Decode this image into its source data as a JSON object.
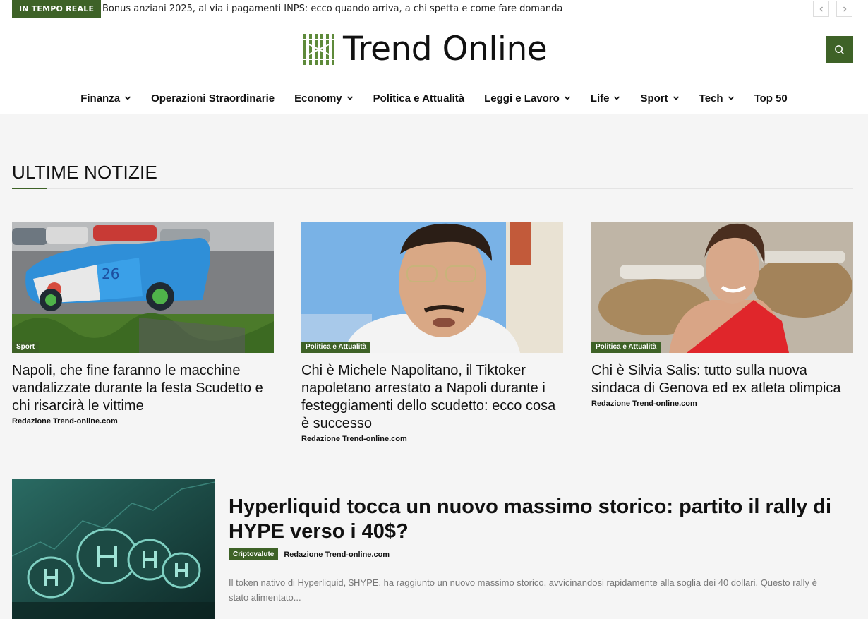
{
  "ticker": {
    "badge": "IN TEMPO REALE",
    "headline": "Bonus anziani 2025, al via i pagamenti INPS: ecco quando arriva, a chi spetta e come fare domanda"
  },
  "brand": {
    "name": "Trend Online",
    "accent_color": "#3e6227"
  },
  "nav": {
    "items": [
      {
        "label": "Finanza",
        "has_dropdown": true
      },
      {
        "label": "Operazioni Straordinarie",
        "has_dropdown": false
      },
      {
        "label": "Economy",
        "has_dropdown": true
      },
      {
        "label": "Politica e Attualità",
        "has_dropdown": false
      },
      {
        "label": "Leggi e Lavoro",
        "has_dropdown": true
      },
      {
        "label": "Life",
        "has_dropdown": true
      },
      {
        "label": "Sport",
        "has_dropdown": true
      },
      {
        "label": "Tech",
        "has_dropdown": true
      },
      {
        "label": "Top 50",
        "has_dropdown": false
      }
    ]
  },
  "section": {
    "title": "ULTIME NOTIZIE"
  },
  "cards": [
    {
      "category": "Sport",
      "title": "Napoli, che fine faranno le macchine vandalizzate durante la festa Scudetto e chi risarcirà le vittime",
      "author": "Redazione Trend-online.com"
    },
    {
      "category": "Politica e Attualità",
      "title": "Chi è Michele Napolitano, il Tiktoker napoletano arrestato a Napoli durante i festeggiamenti dello scudetto: ecco cosa è successo",
      "author": "Redazione Trend-online.com"
    },
    {
      "category": "Politica e Attualità",
      "title": "Chi è Silvia Salis: tutto sulla nuova sindaca di Genova ed ex atleta olimpica",
      "author": "Redazione Trend-online.com"
    }
  ],
  "featured": {
    "title": "Hyperliquid tocca un nuovo massimo storico: partito il rally di HYPE verso i 40$?",
    "category": "Criptovalute",
    "author": "Redazione Trend-online.com",
    "excerpt": "Il token nativo di Hyperliquid, $HYPE, ha raggiunto un nuovo massimo storico, avvicinandosi rapidamente alla soglia dei 40 dollari. Questo rally è stato alimentato..."
  }
}
